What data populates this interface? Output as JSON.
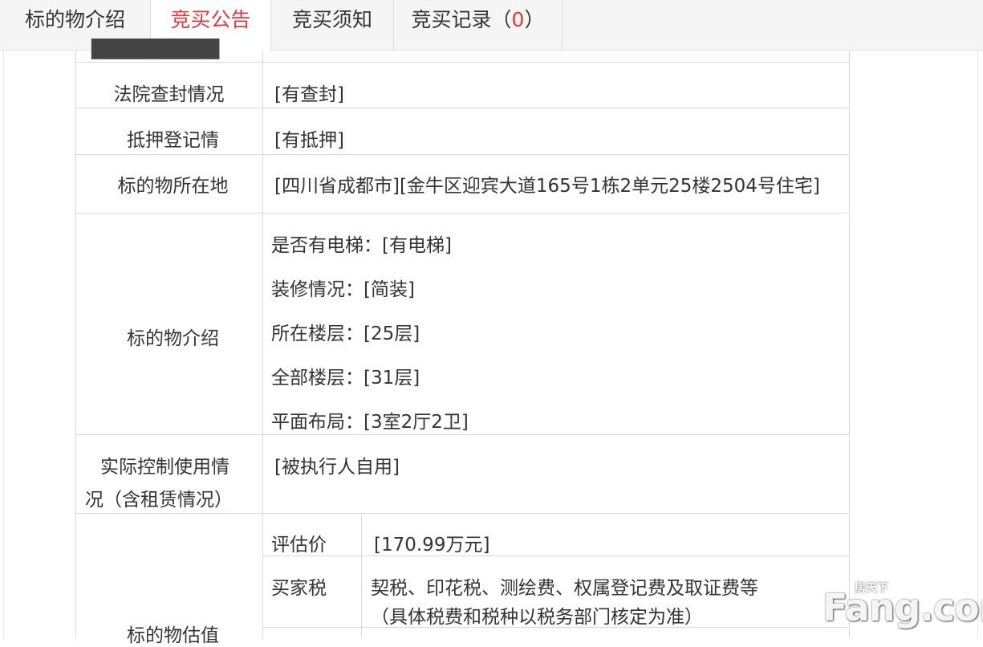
{
  "tabs": [
    {
      "label": "标的物介绍",
      "active": false
    },
    {
      "label": "竞买公告",
      "active": true
    },
    {
      "label": "竞买须知",
      "active": false
    },
    {
      "label": "竞买记录（",
      "count": "0",
      "suffix": "）",
      "active": false
    }
  ],
  "rows": {
    "court_seal": {
      "label": "法院查封情况",
      "value": "[有查封]"
    },
    "mortgage": {
      "label": "抵押登记情",
      "value": "[有抵押]"
    },
    "location": {
      "label": "标的物所在地",
      "value": "[四川省成都市][金牛区迎宾大道165号1栋2单元25楼2504号住宅]"
    },
    "intro": {
      "label": "标的物介绍",
      "items": [
        {
          "key": "是否有电梯：",
          "value": "[有电梯]"
        },
        {
          "key": "装修情况：",
          "value": "[简装]"
        },
        {
          "key": "所在楼层：",
          "value": "[25层]"
        },
        {
          "key": "全部楼层：",
          "value": "[31层]"
        },
        {
          "key": "平面布局：",
          "value": "[3室2厅2卫]"
        }
      ]
    },
    "usage": {
      "label_line1": "实际控制使用情",
      "label_line2": "况（含租赁情况）",
      "value": "[被执行人自用]"
    },
    "valuation": {
      "label": "标的物估值",
      "sub": [
        {
          "key": "评估价",
          "value": "[170.99万元]"
        },
        {
          "key": "买家税",
          "value_line1": "契税、印花税、测绘费、权属登记费及取证费等",
          "value_line2": "（具体税费和税种以税务部门核定为准）"
        }
      ]
    }
  },
  "watermark": {
    "big": "Fang.com",
    "small": "房天下"
  }
}
